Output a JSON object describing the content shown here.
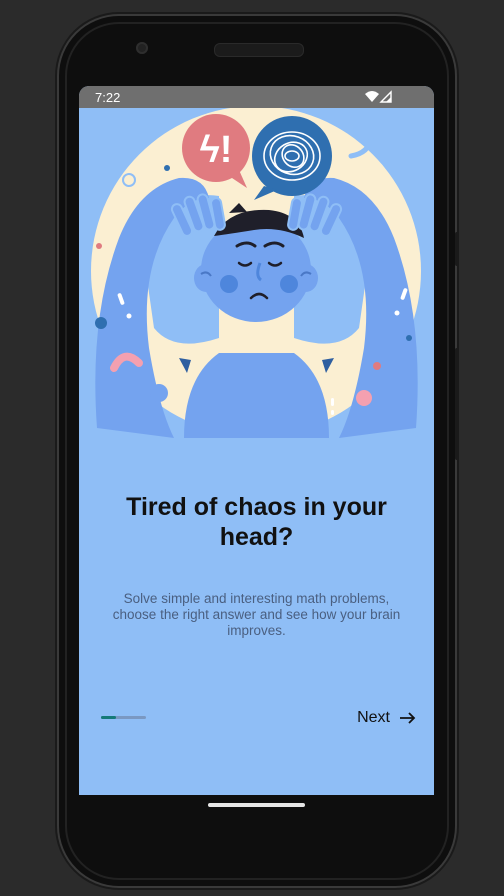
{
  "status_bar": {
    "time": "7:22"
  },
  "illustration": {
    "icon": "stressed-person-illustration",
    "speech_bubble_symbol": "ϟ!"
  },
  "onboarding": {
    "title": "Tired of chaos in your head?",
    "description": "Solve simple and interesting math problems, choose the right answer and see how your brain improves.",
    "progress": 0.33,
    "next_label": "Next",
    "next_icon": "arrow-right-icon"
  },
  "colors": {
    "screen_bg": "#8fbef6",
    "progress_active": "#157a78",
    "progress_track": "#7a98c2",
    "illustration_circle": "#fbefd2",
    "character_blue": "#74a3ef",
    "bubble_red": "#e07b80",
    "bubble_blue": "#2f6fb0"
  }
}
